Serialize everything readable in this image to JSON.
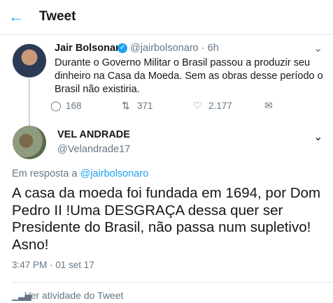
{
  "header": {
    "back_icon": "arrow-left-icon",
    "title": "Tweet",
    "accent": "#1da1f2"
  },
  "parent_tweet": {
    "name": "Jair Bolsonaro",
    "verified": true,
    "handle_time": "@jairbolsonaro · 6h",
    "text": "Durante o Governo Militar o Brasil passou a produzir seu dinheiro na Casa da Moeda. Sem as obras desse período o Brasil não existiria.",
    "replies": "168",
    "retweets": "371",
    "likes": "2.177"
  },
  "reply_tweet": {
    "name": "VEL ANDRADE",
    "handle": "@Velandrade17",
    "reply_prefix": "Em resposta a ",
    "reply_mention": "@jairbolsonaro",
    "text": "A casa da moeda foi fundada em 1694, por Dom Pedro II !Uma DESGRAÇA dessa quer ser Presidente do Brasil, não passa num supletivo! Asno!",
    "timestamp": "3:47 PM · 01 set 17"
  },
  "footer": {
    "activity_label": "Ver atividade do Tweet"
  }
}
